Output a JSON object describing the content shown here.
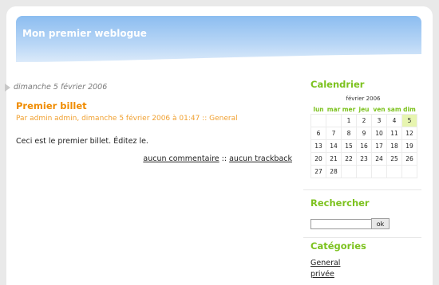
{
  "site": {
    "title": "Mon premier weblogue"
  },
  "main": {
    "date": "dimanche 5 février 2006",
    "post": {
      "title": "Premier billet",
      "meta": "Par admin admin, dimanche 5 février 2006 à 01:47 :: General",
      "body": "Ceci est le premier billet. Éditez le.",
      "comments_link": "aucun commentaire",
      "separator": "::",
      "trackback_link": "aucun trackback"
    }
  },
  "sidebar": {
    "calendar": {
      "heading": "Calendrier",
      "caption": "février 2006",
      "weekdays": [
        "lun",
        "mar",
        "mer",
        "jeu",
        "ven",
        "sam",
        "dim"
      ],
      "weeks": [
        [
          "",
          "",
          "1",
          "2",
          "3",
          "4",
          "5"
        ],
        [
          "6",
          "7",
          "8",
          "9",
          "10",
          "11",
          "12"
        ],
        [
          "13",
          "14",
          "15",
          "16",
          "17",
          "18",
          "19"
        ],
        [
          "20",
          "21",
          "22",
          "23",
          "24",
          "25",
          "26"
        ],
        [
          "27",
          "28",
          "",
          "",
          "",
          "",
          ""
        ]
      ],
      "today": "5"
    },
    "search": {
      "heading": "Rechercher",
      "value": "",
      "button_label": "ok"
    },
    "categories": {
      "heading": "Catégories",
      "items": [
        "General",
        "privée"
      ]
    },
    "colors": {
      "accent_green": "#7cc21e",
      "accent_orange": "#f08c00",
      "today_bg": "#e7f5b0"
    }
  }
}
